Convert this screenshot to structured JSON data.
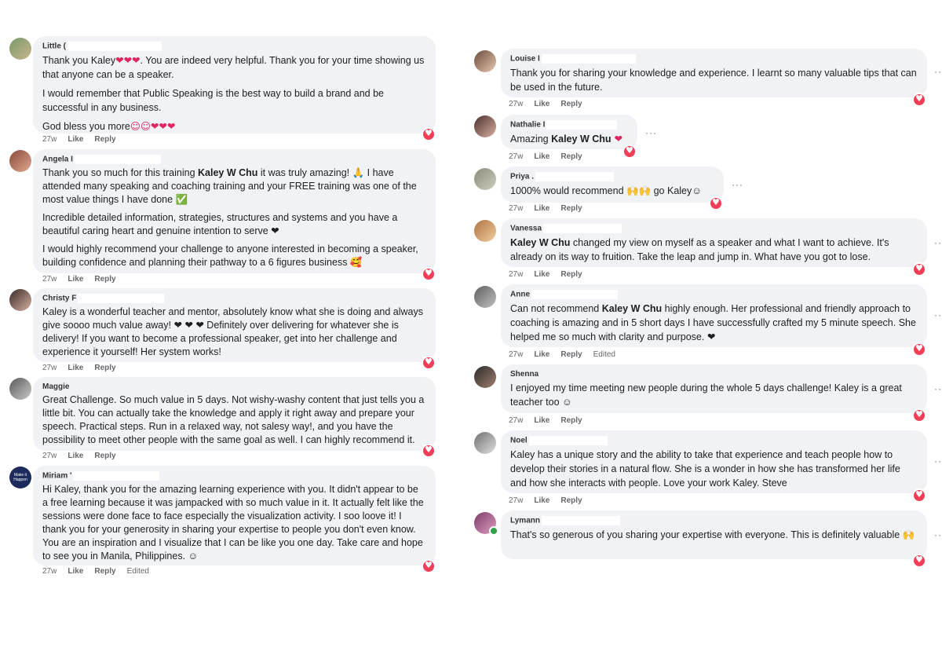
{
  "action_like": "Like",
  "action_reply": "Reply",
  "edited_label": "Edited",
  "comments": {
    "little": {
      "name": "Little (",
      "time": "27w",
      "p1a": "Thank you Kaley",
      "p1_emoji": "❤❤❤",
      "p1b": ". You are indeed very helpful. Thank you for your time showing us that anyone can be a speaker.",
      "p2": "I would remember that Public Speaking is the best way to build a brand and be successful in any business.",
      "p3a": "God bless you more",
      "p3_emoji": "☺☺❤❤❤"
    },
    "angela": {
      "name": "Angela I",
      "time": "27w",
      "p1a": "Thank you so much for this training ",
      "p1_bold": "Kaley W Chu",
      "p1b": " it was truly amazing! 🙏 I have attended many speaking and coaching training and your FREE training was one of the most value things I have done ✅",
      "p2": "Incredible detailed information, strategies, structures and systems and you have a beautiful caring heart and genuine intention to serve ❤",
      "p3": "I would highly recommend your challenge to anyone interested in becoming a speaker, building confidence and planning their pathway to a 6 figures business 🥰"
    },
    "christy": {
      "name": "Christy F",
      "time": "27w",
      "text": "Kaley is a wonderful teacher and mentor, absolutely know what she is doing and always give soooo much value away! ❤ ❤ ❤ Definitely over delivering for whatever she is delivery! If you want to become a professional speaker, get into her challenge and experience it yourself! Her system works!"
    },
    "maggie": {
      "name": "Maggie",
      "time": "27w",
      "text": "Great Challenge. So much value in 5 days. Not wishy-washy content that just tells you a little bit. You can actually take the knowledge and apply it right away and prepare your speech. Practical steps. Run in a relaxed way, not salesy way!, and you have the possibility to meet other people with the same goal as well. I can highly recommend it."
    },
    "miriam": {
      "name": "Miriam '",
      "time": "27w",
      "avatar_text": "Make it Happen",
      "text": "Hi Kaley, thank you for the amazing learning experience with you. It didn't appear to be a free learning because it was jampacked with so much value in it. It actually felt like the sessions were done face to face especially the visualization activity. I soo loove it! I thank you for your generosity in sharing your expertise to people you don't even know. You are an inspiration and I visualize that I can be like you one day. Take care and hope to see you in Manila, Philippines. ☺"
    },
    "louise": {
      "name": "Louise I",
      "time": "27w",
      "text": "Thank you for sharing your knowledge and experience. I learnt so many valuable tips that can be used in the future."
    },
    "nathalie": {
      "name": "Nathalie I",
      "time": "27w",
      "prefix": "Amazing ",
      "bold": "Kaley W Chu",
      "suffix": " ❤"
    },
    "priya": {
      "name": "Priya .",
      "time": "27w",
      "text": "1000% would recommend 🙌🙌 go Kaley☺"
    },
    "vanessa": {
      "name": "Vanessa",
      "time": "27w",
      "bold": "Kaley W Chu",
      "text": " changed my view on myself as a speaker and what I want to achieve. It's already on its way to fruition. Take the leap and jump in. What have you got to lose."
    },
    "anne": {
      "name": "Anne",
      "time": "27w",
      "prefix": "Can not recommend ",
      "bold": "Kaley W Chu",
      "text": " highly enough. Her professional and friendly approach to coaching is amazing and in 5 short days I have successfully crafted my 5 minute speech. She helped me so much with clarity and purpose. ❤"
    },
    "shenna": {
      "name": "Shenna",
      "time": "27w",
      "text": "I enjoyed my time meeting new people during the whole 5 days challenge! Kaley is a great teacher too ☺"
    },
    "noel": {
      "name": "Noel",
      "time": "27w",
      "text": "Kaley has a unique story and the ability to take that experience and teach people how to develop their stories in a natural flow. She is a wonder in how she has transformed her life and how she interacts with people. Love your work Kaley. Steve"
    },
    "lymann": {
      "name": "Lymann",
      "time": "27w",
      "text": "That's so generous of you sharing your expertise with everyone. This is definitely valuable 🙌"
    }
  }
}
